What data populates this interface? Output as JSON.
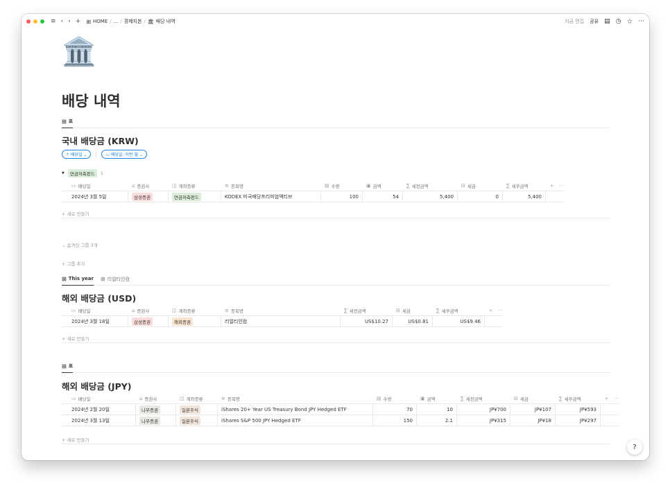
{
  "colors": {
    "close": "#ff5f57",
    "minimize": "#febc2e",
    "zoom": "#28c840",
    "link": "#2383e2"
  },
  "toolbar": {
    "menu_icon": "≡",
    "back_icon": "‹",
    "forward_icon": "›",
    "add_icon": "+",
    "home_icon": "⊞"
  },
  "breadcrumb": {
    "home": "HOME",
    "ellipsis": "...",
    "parent": "경제지본",
    "page_emoji": "🏛",
    "current": "배당 내역",
    "sep": "/"
  },
  "header_actions": {
    "edited": "지금 편집",
    "share": "공유",
    "comment_icon": "▤",
    "clock_icon": "◷",
    "star_icon": "☆",
    "more_icon": "···"
  },
  "page": {
    "icon": "🏛️",
    "title": "배당 내역"
  },
  "krw": {
    "view_tab": "표",
    "title": "국내 배당금 (KRW)",
    "sort_chip": "↑ 배당일 ⌄",
    "filter_chip": "▭ 배당일: 이번 월 ⌄",
    "group": {
      "toggle": "▼",
      "label": "연금저축펀드",
      "count": "1"
    },
    "headers": [
      {
        "icon": "▭",
        "label": "배당일"
      },
      {
        "icon": "⌂",
        "label": "증권사"
      },
      {
        "icon": "◫",
        "label": "계좌종류"
      },
      {
        "icon": "≡",
        "label": "종목명"
      },
      {
        "icon": "▤",
        "label": "수량"
      },
      {
        "icon": "▣",
        "label": "금액"
      },
      {
        "icon": "∑",
        "label": "세전금액"
      },
      {
        "icon": "⊟",
        "label": "세금"
      },
      {
        "icon": "∑",
        "label": "세후금액"
      }
    ],
    "rows": [
      {
        "date": "2024년 3월 5일",
        "broker": "삼성증권",
        "account": "연금저축펀드",
        "name": "KODEX 미국배당프리미엄액티브",
        "qty": "100",
        "amount": "54",
        "pretax": "5,400",
        "tax": "0",
        "aftertax": "5,400"
      }
    ],
    "new_row": "+ 새로 만들기",
    "hidden_groups": "⌄ 숨겨진 그룹 3개",
    "add_group": "+ 그룹 추가"
  },
  "usd": {
    "tabs": [
      {
        "label": "This year"
      },
      {
        "label": "리얼티인컴"
      }
    ],
    "title": "해외 배당금 (USD)",
    "headers": [
      {
        "icon": "▭",
        "label": "배당일"
      },
      {
        "icon": "⌂",
        "label": "증권사"
      },
      {
        "icon": "◫",
        "label": "계좌종류"
      },
      {
        "icon": "≡",
        "label": "종목명"
      },
      {
        "icon": "∑",
        "label": "세전금액"
      },
      {
        "icon": "⊟",
        "label": "세금"
      },
      {
        "icon": "∑",
        "label": "세후금액"
      }
    ],
    "rows": [
      {
        "date": "2024년 3월 18일",
        "broker": "삼성증권",
        "account": "해외증권",
        "name": "리얼티인컴",
        "pretax": "US$10.27",
        "tax": "US$0.81",
        "aftertax": "US$9.46"
      }
    ],
    "new_row": "+ 새로 만들기"
  },
  "jpy": {
    "view_tab": "표",
    "title": "해외 배당금 (JPY)",
    "headers": [
      {
        "icon": "▭",
        "label": "배당일"
      },
      {
        "icon": "⌂",
        "label": "증권사"
      },
      {
        "icon": "◫",
        "label": "계좌종류"
      },
      {
        "icon": "≡",
        "label": "종목명"
      },
      {
        "icon": "▤",
        "label": "수량"
      },
      {
        "icon": "▣",
        "label": "금액"
      },
      {
        "icon": "∑",
        "label": "세전금액"
      },
      {
        "icon": "⊟",
        "label": "세금"
      },
      {
        "icon": "∑",
        "label": "세후금액"
      }
    ],
    "rows": [
      {
        "date": "2024년 2월 20일",
        "broker": "나무증권",
        "account": "일본주식",
        "name": "iShares 20+ Year US Treasury Bond JPY Hedged ETF",
        "qty": "70",
        "amount": "10",
        "pretax": "JP¥700",
        "tax": "JP¥107",
        "aftertax": "JP¥593"
      },
      {
        "date": "2024년 3월 13일",
        "broker": "나무증권",
        "account": "일본주식",
        "name": "iShares S&P 500 JPY Hedged ETF",
        "qty": "150",
        "amount": "2.1",
        "pretax": "JP¥315",
        "tax": "JP¥18",
        "aftertax": "JP¥297"
      }
    ],
    "new_row": "+ 새로 만들기"
  },
  "table_controls": {
    "add_col": "+",
    "more": "···"
  },
  "help": "?"
}
